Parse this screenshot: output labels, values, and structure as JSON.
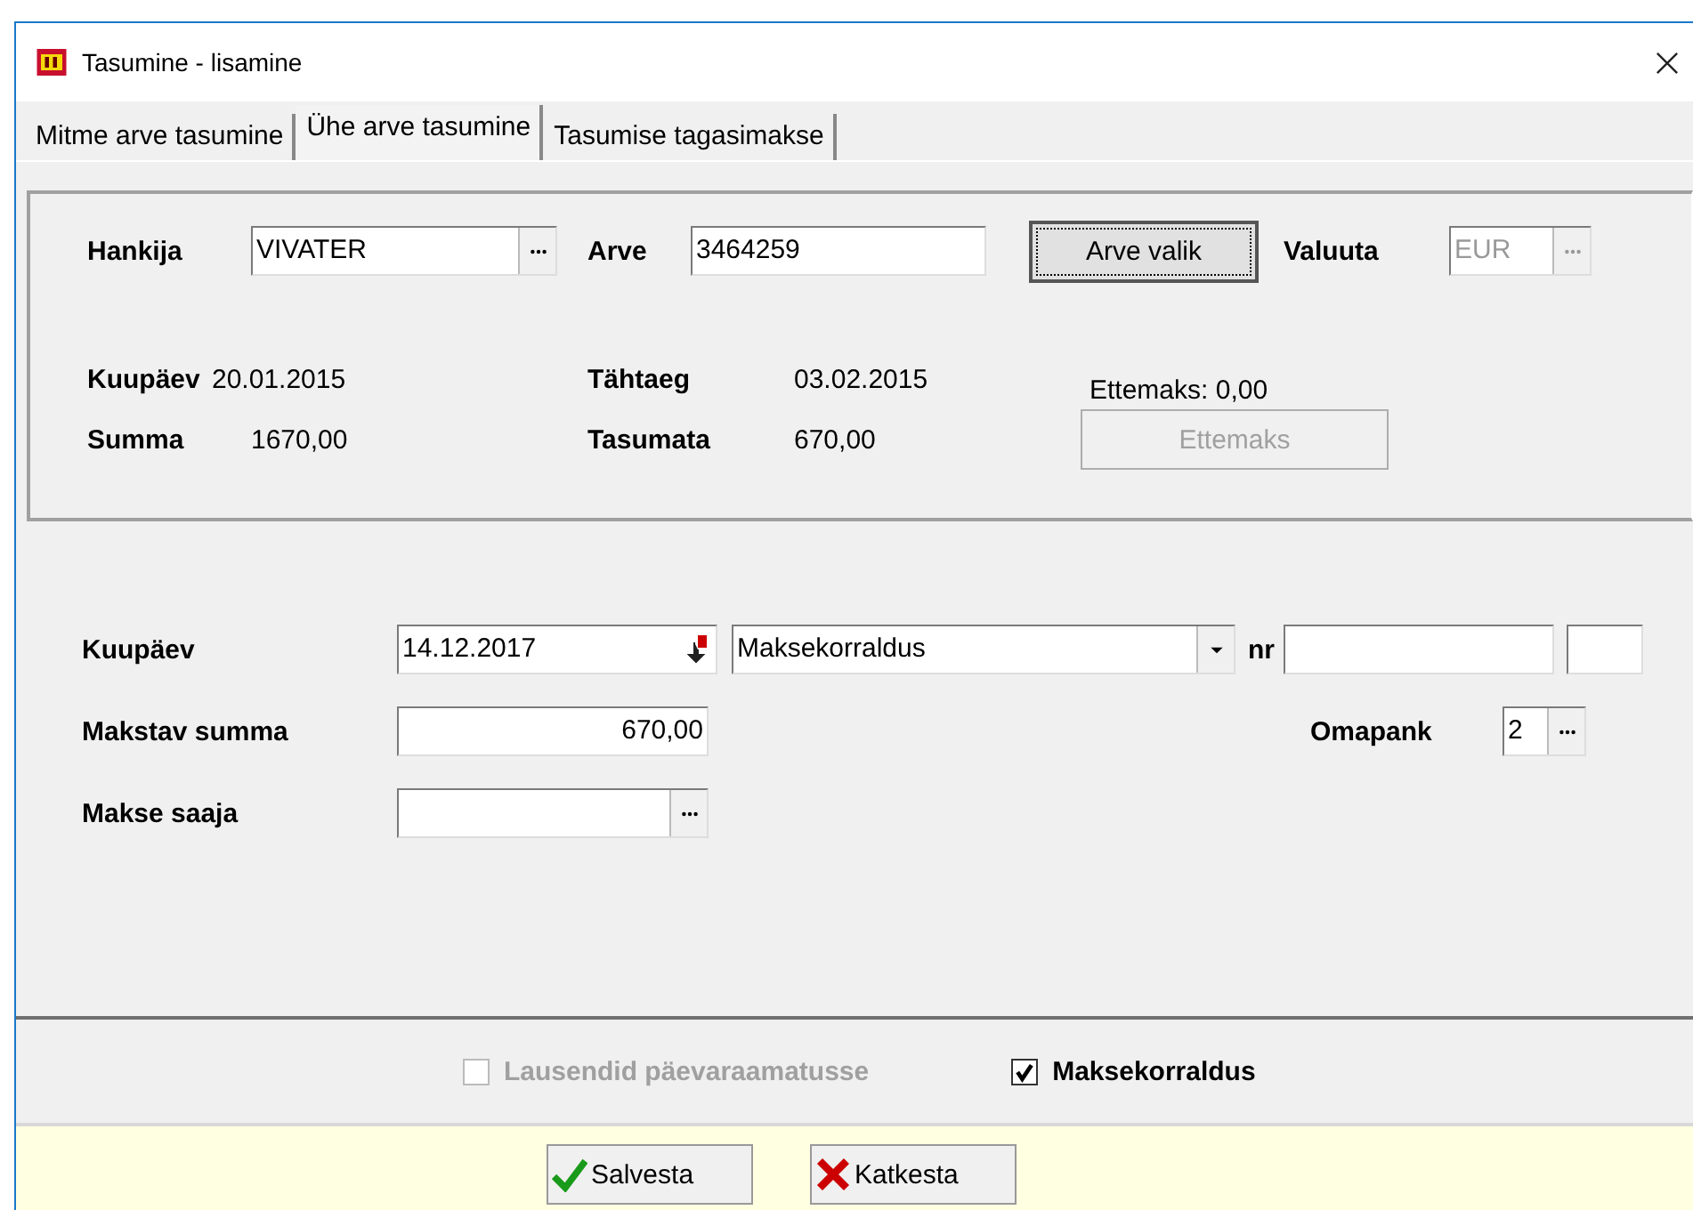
{
  "window": {
    "title": "Tasumine - lisamine"
  },
  "tabs": [
    {
      "label": "Mitme arve tasumine",
      "selected": false
    },
    {
      "label": "Ühe arve tasumine",
      "selected": true
    },
    {
      "label": "Tasumise tagasimakse",
      "selected": false
    }
  ],
  "invoice_box": {
    "supplier_label": "Hankija",
    "supplier_value": "VIVATER",
    "invoice_label": "Arve",
    "invoice_value": "3464259",
    "select_button": "Arve valik",
    "currency_label": "Valuuta",
    "currency_value": "EUR",
    "currency_disabled": true,
    "date_label": "Kuupäev",
    "date_value": "20.01.2015",
    "due_label": "Tähtaeg",
    "due_value": "03.02.2015",
    "prepayment_text": "Ettemaks: 0,00",
    "sum_label": "Summa",
    "sum_value": "1670,00",
    "unpaid_label": "Tasumata",
    "unpaid_value": "670,00",
    "prepayment_button": {
      "label": "Ettemaks",
      "disabled": true
    }
  },
  "payment": {
    "date_label": "Kuupäev",
    "date_value": "14.12.2017",
    "type_value": "Maksekorraldus",
    "nr_label": "nr",
    "amount_label": "Makstav summa",
    "amount_value": "670,00",
    "bank_label": "Omapank",
    "bank_value": "2",
    "recipient_label": "Makse saaja"
  },
  "checkboxes": [
    {
      "label": "Lausendid päevaraamatusse",
      "checked": false,
      "disabled": true
    },
    {
      "label": "Maksekorraldus",
      "checked": true,
      "disabled": false
    }
  ],
  "buttons": [
    {
      "label": "Salvesta",
      "kind": "save"
    },
    {
      "label": "Katkesta",
      "kind": "cancel"
    }
  ]
}
